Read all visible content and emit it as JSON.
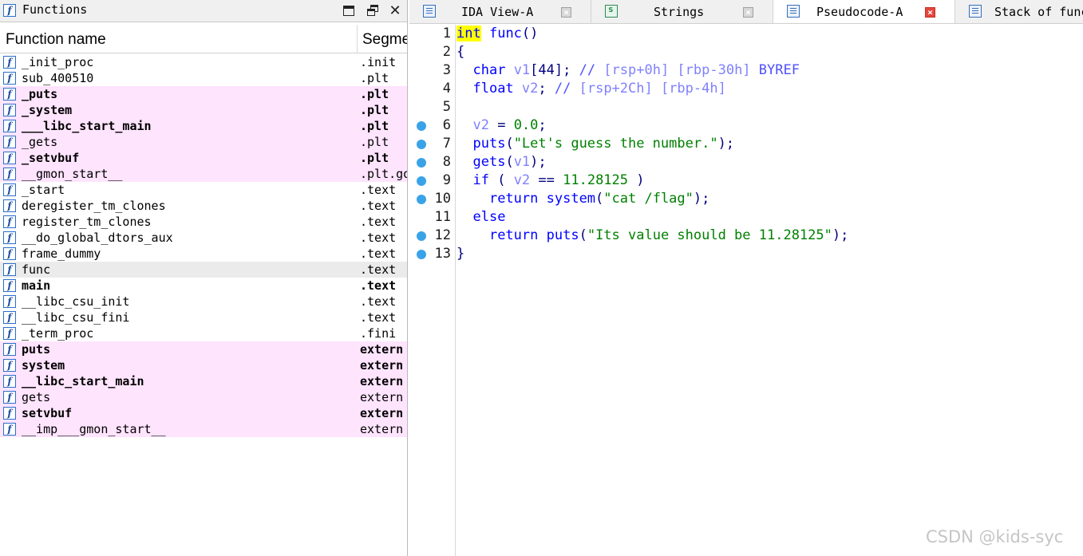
{
  "functions_panel": {
    "title": "Functions",
    "columns": {
      "name": "Function name",
      "segment": "Segme"
    },
    "rows": [
      {
        "name": "_init_proc",
        "segment": ".init",
        "imported": false,
        "bold": false,
        "selected": false
      },
      {
        "name": "sub_400510",
        "segment": ".plt",
        "imported": false,
        "bold": false,
        "selected": false
      },
      {
        "name": "_puts",
        "segment": ".plt",
        "imported": true,
        "bold": true,
        "selected": false
      },
      {
        "name": "_system",
        "segment": ".plt",
        "imported": true,
        "bold": true,
        "selected": false
      },
      {
        "name": "___libc_start_main",
        "segment": ".plt",
        "imported": true,
        "bold": true,
        "selected": false
      },
      {
        "name": "_gets",
        "segment": ".plt",
        "imported": true,
        "bold": false,
        "selected": false
      },
      {
        "name": "_setvbuf",
        "segment": ".plt",
        "imported": true,
        "bold": true,
        "selected": false
      },
      {
        "name": "__gmon_start__",
        "segment": ".plt.go",
        "imported": true,
        "bold": false,
        "selected": false
      },
      {
        "name": "_start",
        "segment": ".text",
        "imported": false,
        "bold": false,
        "selected": false
      },
      {
        "name": "deregister_tm_clones",
        "segment": ".text",
        "imported": false,
        "bold": false,
        "selected": false
      },
      {
        "name": "register_tm_clones",
        "segment": ".text",
        "imported": false,
        "bold": false,
        "selected": false
      },
      {
        "name": "__do_global_dtors_aux",
        "segment": ".text",
        "imported": false,
        "bold": false,
        "selected": false
      },
      {
        "name": "frame_dummy",
        "segment": ".text",
        "imported": false,
        "bold": false,
        "selected": false
      },
      {
        "name": "func",
        "segment": ".text",
        "imported": false,
        "bold": false,
        "selected": true
      },
      {
        "name": "main",
        "segment": ".text",
        "imported": false,
        "bold": true,
        "selected": false
      },
      {
        "name": "__libc_csu_init",
        "segment": ".text",
        "imported": false,
        "bold": false,
        "selected": false
      },
      {
        "name": "__libc_csu_fini",
        "segment": ".text",
        "imported": false,
        "bold": false,
        "selected": false
      },
      {
        "name": "_term_proc",
        "segment": ".fini",
        "imported": false,
        "bold": false,
        "selected": false
      },
      {
        "name": "puts",
        "segment": "extern",
        "imported": true,
        "bold": true,
        "selected": false
      },
      {
        "name": "system",
        "segment": "extern",
        "imported": true,
        "bold": true,
        "selected": false
      },
      {
        "name": "__libc_start_main",
        "segment": "extern",
        "imported": true,
        "bold": true,
        "selected": false
      },
      {
        "name": "gets",
        "segment": "extern",
        "imported": true,
        "bold": false,
        "selected": false
      },
      {
        "name": "setvbuf",
        "segment": "extern",
        "imported": true,
        "bold": true,
        "selected": false
      },
      {
        "name": "__imp___gmon_start__",
        "segment": "extern",
        "imported": true,
        "bold": false,
        "selected": false
      }
    ]
  },
  "tabs": [
    {
      "label": "IDA View-A",
      "icon": "ida-view-icon",
      "active": false
    },
    {
      "label": "Strings",
      "icon": "strings-icon",
      "active": false
    },
    {
      "label": "Pseudocode-A",
      "icon": "pseudocode-icon",
      "active": true
    },
    {
      "label": "Stack of func",
      "icon": "stack-icon",
      "active": false
    }
  ],
  "pseudocode": {
    "lines": [
      {
        "n": "1",
        "bp": false,
        "tokens": [
          [
            "kw-hl",
            "int"
          ],
          [
            "pl",
            " "
          ],
          [
            "fn",
            "func"
          ],
          [
            "pl",
            "()"
          ]
        ]
      },
      {
        "n": "2",
        "bp": false,
        "tokens": [
          [
            "brace",
            "{"
          ]
        ]
      },
      {
        "n": "3",
        "bp": false,
        "tokens": [
          [
            "pl",
            "  "
          ],
          [
            "kw",
            "char"
          ],
          [
            "pl",
            " "
          ],
          [
            "var",
            "v1"
          ],
          [
            "pl",
            "[44]; "
          ],
          [
            "cmt",
            "// "
          ],
          [
            "cmt-addr",
            "[rsp+0h] [rbp-30h]"
          ],
          [
            "cmt",
            " BYREF"
          ]
        ]
      },
      {
        "n": "4",
        "bp": false,
        "tokens": [
          [
            "pl",
            "  "
          ],
          [
            "kw",
            "float"
          ],
          [
            "pl",
            " "
          ],
          [
            "var",
            "v2"
          ],
          [
            "pl",
            "; "
          ],
          [
            "cmt",
            "// "
          ],
          [
            "cmt-addr",
            "[rsp+2Ch] [rbp-4h]"
          ]
        ]
      },
      {
        "n": "5",
        "bp": false,
        "tokens": []
      },
      {
        "n": "6",
        "bp": true,
        "tokens": [
          [
            "pl",
            "  "
          ],
          [
            "var",
            "v2"
          ],
          [
            "pl",
            " = "
          ],
          [
            "num",
            "0.0"
          ],
          [
            "pl",
            ";"
          ]
        ]
      },
      {
        "n": "7",
        "bp": true,
        "tokens": [
          [
            "pl",
            "  "
          ],
          [
            "fn",
            "puts"
          ],
          [
            "pl",
            "("
          ],
          [
            "str",
            "\"Let's guess the number.\""
          ],
          [
            "pl",
            ");"
          ]
        ]
      },
      {
        "n": "8",
        "bp": true,
        "tokens": [
          [
            "pl",
            "  "
          ],
          [
            "fn",
            "gets"
          ],
          [
            "pl",
            "("
          ],
          [
            "var",
            "v1"
          ],
          [
            "pl",
            ");"
          ]
        ]
      },
      {
        "n": "9",
        "bp": true,
        "tokens": [
          [
            "pl",
            "  "
          ],
          [
            "kw",
            "if"
          ],
          [
            "pl",
            " ( "
          ],
          [
            "var",
            "v2"
          ],
          [
            "pl",
            " == "
          ],
          [
            "num",
            "11.28125"
          ],
          [
            "pl",
            " )"
          ]
        ]
      },
      {
        "n": "10",
        "bp": true,
        "tokens": [
          [
            "pl",
            "    "
          ],
          [
            "kw",
            "return"
          ],
          [
            "pl",
            " "
          ],
          [
            "fn",
            "system"
          ],
          [
            "pl",
            "("
          ],
          [
            "str",
            "\"cat /flag\""
          ],
          [
            "pl",
            ");"
          ]
        ]
      },
      {
        "n": "11",
        "bp": false,
        "tokens": [
          [
            "pl",
            "  "
          ],
          [
            "kw",
            "else"
          ]
        ]
      },
      {
        "n": "12",
        "bp": true,
        "tokens": [
          [
            "pl",
            "    "
          ],
          [
            "kw",
            "return"
          ],
          [
            "pl",
            " "
          ],
          [
            "fn",
            "puts"
          ],
          [
            "pl",
            "("
          ],
          [
            "str",
            "\"Its value should be 11.28125\""
          ],
          [
            "pl",
            ");"
          ]
        ]
      },
      {
        "n": "13",
        "bp": true,
        "tokens": [
          [
            "brace",
            "}"
          ]
        ]
      }
    ]
  },
  "watermark": "CSDN @kids-syc",
  "colors": {
    "import_row_bg": "#ffe4fe",
    "selected_row_bg": "#ebebeb",
    "keyword": "#0000ff",
    "variable": "#8080ff",
    "string": "#008000",
    "breakpoint": "#3aa3e8",
    "active_tab_close": "#e4483c"
  }
}
